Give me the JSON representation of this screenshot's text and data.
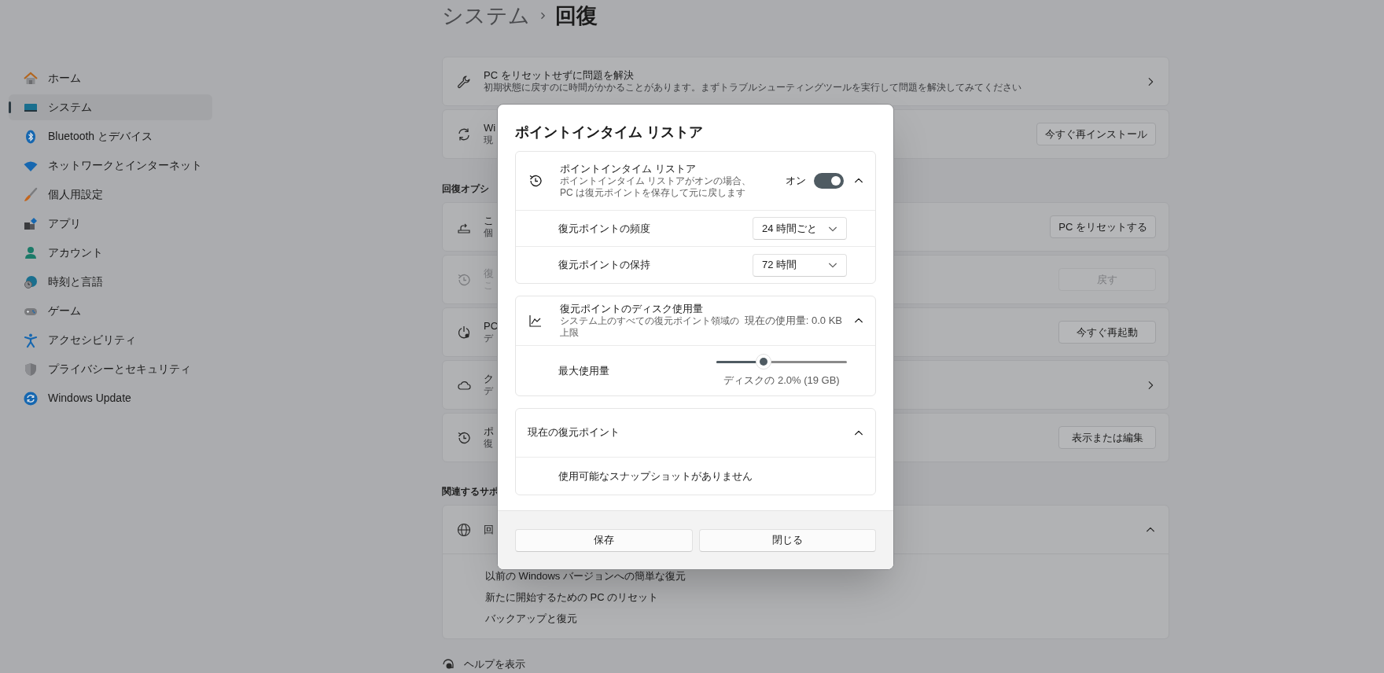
{
  "breadcrumb": {
    "parent": "システム",
    "current": "回復"
  },
  "sidebar": {
    "items": [
      {
        "label": "ホーム",
        "selected": false
      },
      {
        "label": "システム",
        "selected": true
      },
      {
        "label": "Bluetooth とデバイス",
        "selected": false
      },
      {
        "label": "ネットワークとインターネット",
        "selected": false
      },
      {
        "label": "個人用設定",
        "selected": false
      },
      {
        "label": "アプリ",
        "selected": false
      },
      {
        "label": "アカウント",
        "selected": false
      },
      {
        "label": "時刻と言語",
        "selected": false
      },
      {
        "label": "ゲーム",
        "selected": false
      },
      {
        "label": "アクセシビリティ",
        "selected": false
      },
      {
        "label": "プライバシーとセキュリティ",
        "selected": false
      },
      {
        "label": "Windows Update",
        "selected": false
      }
    ]
  },
  "top_cards": [
    {
      "title": "PC をリセットせずに問題を解決",
      "description": "初期状態に戻すのに時間がかかることがあります。まずトラブルシューティングツールを実行して問題を解決してみてください",
      "action": {
        "kind": "chevron"
      },
      "disabled": false
    },
    {
      "title": "Wi",
      "description": "現",
      "action": {
        "kind": "button",
        "label": "今すぐ再インストール"
      },
      "disabled": false
    }
  ],
  "recovery_options": {
    "heading": "回復オプシ",
    "cards": [
      {
        "title": "こ",
        "description": "個",
        "action": {
          "kind": "button",
          "label": "PC をリセットする"
        },
        "disabled": false
      },
      {
        "title": "復",
        "description": "こ",
        "action": {
          "kind": "button",
          "label": "戻す"
        },
        "disabled": true
      },
      {
        "title": "PC",
        "description": "デ",
        "action": {
          "kind": "button",
          "label": "今すぐ再起動"
        },
        "disabled": false
      },
      {
        "title": "ク",
        "description": "デ",
        "action": {
          "kind": "chevron"
        },
        "disabled": false
      },
      {
        "title": "ポ",
        "description": "復",
        "action": {
          "kind": "button",
          "label": "表示または編集"
        },
        "disabled": false
      }
    ]
  },
  "related_support": {
    "heading": "関連するサポ",
    "card": {
      "title": "回",
      "expanded": true,
      "links": [
        "以前の Windows バージョンへの簡単な復元",
        "新たに開始するための PC のリセット",
        "バックアップと復元"
      ]
    }
  },
  "help_link": "ヘルプを表示",
  "dialog": {
    "title": "ポイントインタイム リストア",
    "sections": [
      {
        "kind": "toggle",
        "title": "ポイントインタイム リストア",
        "description": "ポイントインタイム リストアがオンの場合、PC は復元ポイントを保存して元に戻します",
        "state_label": "オン",
        "on": true,
        "expanded": true,
        "rows": [
          {
            "kind": "dropdown",
            "label": "復元ポイントの頻度",
            "value": "24 時間ごと"
          },
          {
            "kind": "dropdown",
            "label": "復元ポイントの保持",
            "value": "72 時間"
          }
        ]
      },
      {
        "kind": "usage",
        "title": "復元ポイントのディスク使用量",
        "description": "システム上のすべての復元ポイント領域の上限",
        "reading": "現在の使用量: 0.0 KB",
        "expanded": true,
        "rows": [
          {
            "kind": "slider",
            "label": "最大使用量",
            "level": 0.36,
            "caption": "ディスクの 2.0% (19 GB)"
          }
        ]
      },
      {
        "kind": "plain",
        "title": "現在の復元ポイント",
        "expanded": true,
        "rows": [
          {
            "kind": "text",
            "label": "使用可能なスナップショットがありません"
          }
        ]
      }
    ],
    "buttons": [
      "保存",
      "閉じる"
    ]
  }
}
